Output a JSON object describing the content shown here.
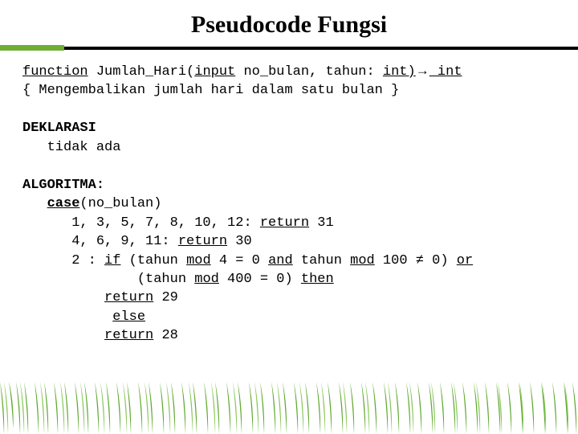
{
  "title": "Pseudocode Fungsi",
  "sig": {
    "kw_function": "function",
    "name": " Jumlah_Hari(",
    "kw_input": "input",
    "params": " no_bulan, tahun: ",
    "type1": "int",
    "paren": ")",
    "arrow": "→",
    "type2": " int"
  },
  "desc": "{ Mengembalikan jumlah hari dalam satu bulan }",
  "dekl_label": "DEKLARASI",
  "dekl_body": "   tidak ada",
  "algo_label": "ALGORITMA:",
  "case": {
    "indent1": "   ",
    "kw_case": "case",
    "arg": "(no_bulan)",
    "row1_vals": "      1, 3, 5, 7, 8, 10, 12: ",
    "row1_ret": "return",
    "row1_num": " 31",
    "row2_vals": "      4, 6, 9, 11: ",
    "row2_ret": "return",
    "row2_num": " 30",
    "row3_pre": "      2 : ",
    "kw_if": "if",
    "cond1a": " (tahun ",
    "kw_mod1": "mod",
    "cond1b": " 4 = 0 ",
    "kw_and": "and",
    "cond1c": " tahun ",
    "kw_mod2": "mod",
    "cond1d": " 100 ≠ 0) ",
    "kw_or": "or",
    "cond2_pre": "              (tahun ",
    "kw_mod3": "mod",
    "cond2_post": " 400 = 0) ",
    "kw_then": "then",
    "ret29_pre": "          ",
    "kw_ret29": "return",
    "ret29_num": " 29",
    "else_pre": "           ",
    "kw_else": "else",
    "ret28_pre": "          ",
    "kw_ret28": "return",
    "ret28_num": " 28"
  }
}
